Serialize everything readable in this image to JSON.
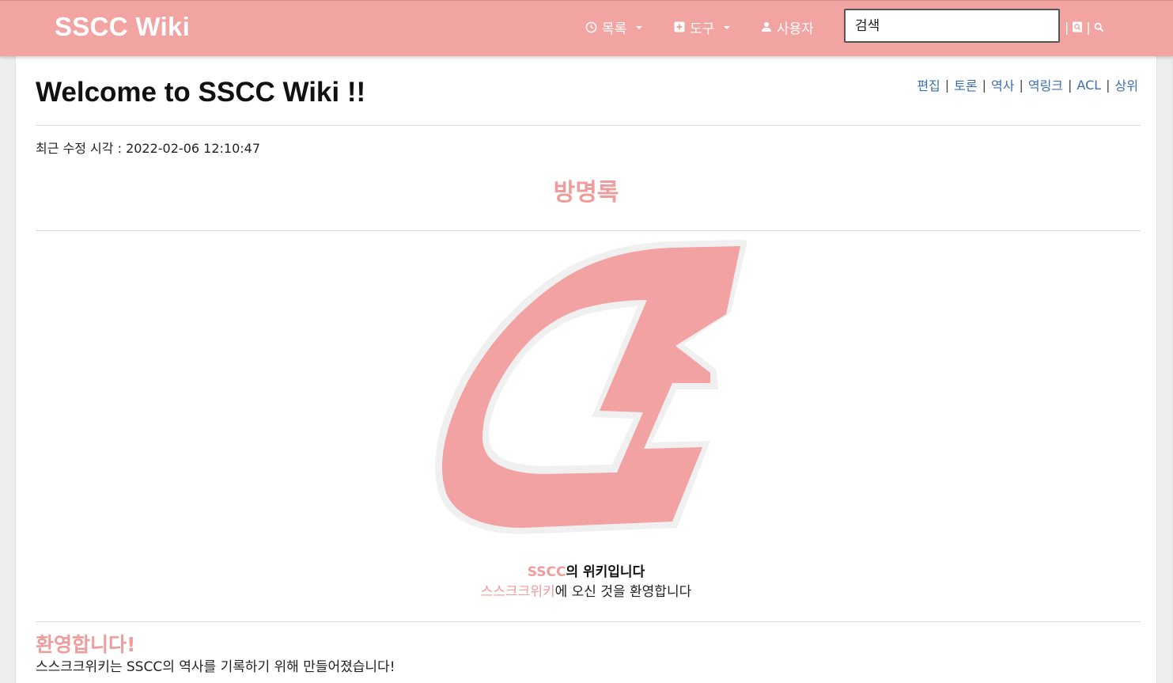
{
  "header": {
    "brand": "SSCC Wiki",
    "nav": [
      {
        "label": "목록",
        "icon": "clock-icon",
        "has_dropdown": true
      },
      {
        "label": "도구",
        "icon": "plus-box-icon",
        "has_dropdown": true
      },
      {
        "label": "사용자",
        "icon": "user-icon",
        "has_dropdown": false
      }
    ],
    "search": {
      "value": "",
      "placeholder": "검색"
    },
    "search_sep": "|",
    "search_buttons": [
      "go-icon",
      "search-icon"
    ],
    "accent_color": "#f2a4a3"
  },
  "page": {
    "title": "Welcome to SSCC Wiki !!",
    "actions": [
      "편집",
      "토론",
      "역사",
      "역링크",
      "ACL",
      "상위"
    ],
    "action_sep": "|",
    "last_modified_label": "최근 수정 시각 :",
    "last_modified_value": "2022-02-06 12:10:47",
    "guestbook_heading": "방명록",
    "caption_brand": "SSCC",
    "caption_rest": "의 위키입니다",
    "caption2_link": "스스크크위키",
    "caption2_rest": "에 오신 것을 환영합니다",
    "welcome_heading": "환영합니다!",
    "welcome_text": "스스크크위키는 SSCC의 역사를 기록하기 위해 만들어졌습니다!",
    "pink_color": "#ef9c9c",
    "link_color": "#3a6fb0"
  }
}
